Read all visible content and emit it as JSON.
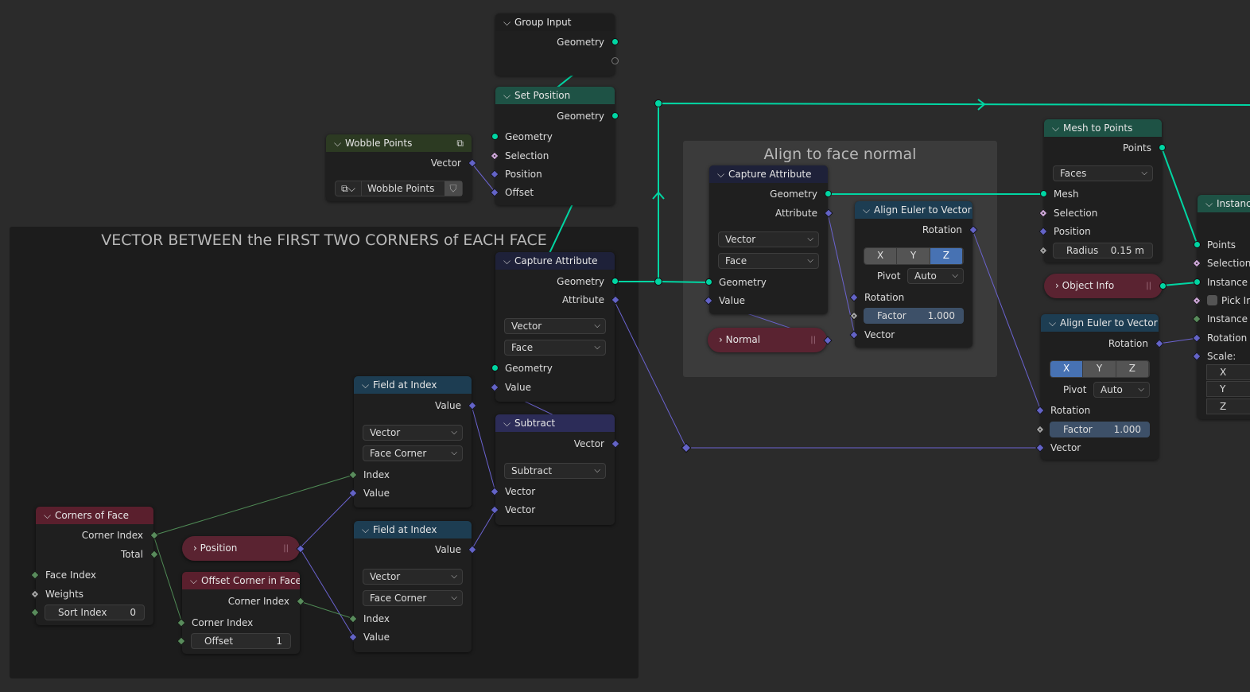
{
  "colors": {
    "background": "#2b2b2b",
    "geometry_socket": "#00d6a3",
    "vector_socket": "#6363c7",
    "int_socket": "#598c5c",
    "bool_socket": "#cca6d6",
    "float_socket": "#a1a1a1",
    "xyz_active": "#4772b3"
  },
  "frames": [
    {
      "id": "frame-vector",
      "title": "VECTOR BETWEEN the FIRST TWO CORNERS of EACH FACE"
    },
    {
      "id": "frame-align",
      "title": "Align to face normal"
    }
  ],
  "nodes": [
    {
      "id": "group-input",
      "title": "Group Input",
      "kind": "group",
      "rows": [
        {
          "t": "out",
          "label": "Geometry",
          "s": "geometry"
        },
        {
          "t": "out",
          "label": "",
          "s": "empty"
        }
      ]
    },
    {
      "id": "set-position",
      "title": "Set Position",
      "kind": "geometry",
      "rows": [
        {
          "t": "out",
          "label": "Geometry",
          "s": "geometry"
        },
        {
          "t": "in",
          "label": "Geometry",
          "s": "geometry"
        },
        {
          "t": "in",
          "label": "Selection",
          "s": "bool"
        },
        {
          "t": "in",
          "label": "Position",
          "s": "vector"
        },
        {
          "t": "in",
          "label": "Offset",
          "s": "vector"
        }
      ]
    },
    {
      "id": "wobble-points",
      "title": "Wobble Points",
      "kind": "nodegroup",
      "icon": "node-group-icon",
      "rows": [
        {
          "t": "out",
          "label": "Vector",
          "s": "vector"
        },
        {
          "t": "group",
          "value": "Wobble Points"
        }
      ]
    },
    {
      "id": "capture-attribute-1",
      "title": "Capture Attribute",
      "kind": "attribute",
      "rows": [
        {
          "t": "out",
          "label": "Geometry",
          "s": "geometry"
        },
        {
          "t": "out",
          "label": "Attribute",
          "s": "vector"
        },
        {
          "t": "select",
          "value": "Vector"
        },
        {
          "t": "select",
          "value": "Face"
        },
        {
          "t": "in",
          "label": "Geometry",
          "s": "geometry"
        },
        {
          "t": "in",
          "label": "Value",
          "s": "vector"
        }
      ]
    },
    {
      "id": "subtract",
      "title": "Subtract",
      "kind": "vector",
      "rows": [
        {
          "t": "out",
          "label": "Vector",
          "s": "vector"
        },
        {
          "t": "select",
          "value": "Subtract"
        },
        {
          "t": "in",
          "label": "Vector",
          "s": "vector"
        },
        {
          "t": "in",
          "label": "Vector",
          "s": "vector"
        }
      ]
    },
    {
      "id": "field-at-index-1",
      "title": "Field at Index",
      "kind": "utility",
      "rows": [
        {
          "t": "out",
          "label": "Value",
          "s": "vector"
        },
        {
          "t": "select",
          "value": "Vector"
        },
        {
          "t": "select",
          "value": "Face Corner"
        },
        {
          "t": "in",
          "label": "Index",
          "s": "int"
        },
        {
          "t": "in",
          "label": "Value",
          "s": "vector"
        }
      ]
    },
    {
      "id": "field-at-index-2",
      "title": "Field at Index",
      "kind": "utility",
      "rows": [
        {
          "t": "out",
          "label": "Value",
          "s": "vector"
        },
        {
          "t": "select",
          "value": "Vector"
        },
        {
          "t": "select",
          "value": "Face Corner"
        },
        {
          "t": "in",
          "label": "Index",
          "s": "int"
        },
        {
          "t": "in",
          "label": "Value",
          "s": "vector"
        }
      ]
    },
    {
      "id": "corners-of-face",
      "title": "Corners of Face",
      "kind": "input",
      "rows": [
        {
          "t": "out",
          "label": "Corner Index",
          "s": "int"
        },
        {
          "t": "out",
          "label": "Total",
          "s": "int"
        },
        {
          "t": "in",
          "label": "Face Index",
          "s": "int"
        },
        {
          "t": "in",
          "label": "Weights",
          "s": "float"
        },
        {
          "t": "num",
          "label": "Sort Index",
          "value": "0",
          "s": "int"
        }
      ]
    },
    {
      "id": "offset-corner-in-face",
      "title": "Offset Corner in Face",
      "kind": "input",
      "rows": [
        {
          "t": "out",
          "label": "Corner Index",
          "s": "int"
        },
        {
          "t": "in",
          "label": "Corner Index",
          "s": "int"
        },
        {
          "t": "num",
          "label": "Offset",
          "value": "1",
          "s": "int"
        }
      ]
    },
    {
      "id": "capture-attribute-2",
      "title": "Capture Attribute",
      "kind": "attribute",
      "rows": [
        {
          "t": "out",
          "label": "Geometry",
          "s": "geometry"
        },
        {
          "t": "out",
          "label": "Attribute",
          "s": "vector"
        },
        {
          "t": "select",
          "value": "Vector"
        },
        {
          "t": "select",
          "value": "Face"
        },
        {
          "t": "in",
          "label": "Geometry",
          "s": "geometry"
        },
        {
          "t": "in",
          "label": "Value",
          "s": "vector"
        }
      ]
    },
    {
      "id": "align-euler-1",
      "title": "Align Euler to Vector",
      "kind": "utility",
      "rows": [
        {
          "t": "out",
          "label": "Rotation",
          "s": "vector"
        },
        {
          "t": "xyz",
          "options": [
            "X",
            "Y",
            "Z"
          ],
          "active": "Z"
        },
        {
          "t": "pivot",
          "label": "Pivot",
          "value": "Auto"
        },
        {
          "t": "in",
          "label": "Rotation",
          "s": "vector"
        },
        {
          "t": "factor",
          "label": "Factor",
          "value": "1.000",
          "s": "float"
        },
        {
          "t": "in",
          "label": "Vector",
          "s": "vector"
        }
      ]
    },
    {
      "id": "mesh-to-points",
      "title": "Mesh to Points",
      "kind": "geometry",
      "rows": [
        {
          "t": "out",
          "label": "Points",
          "s": "geometry"
        },
        {
          "t": "select",
          "value": "Faces"
        },
        {
          "t": "in",
          "label": "Mesh",
          "s": "geometry"
        },
        {
          "t": "in",
          "label": "Selection",
          "s": "bool"
        },
        {
          "t": "in",
          "label": "Position",
          "s": "vector"
        },
        {
          "t": "num",
          "label": "Radius",
          "value": "0.15 m",
          "s": "float"
        }
      ]
    },
    {
      "id": "align-euler-2",
      "title": "Align Euler to Vector",
      "kind": "utility",
      "rows": [
        {
          "t": "out",
          "label": "Rotation",
          "s": "vector"
        },
        {
          "t": "xyz",
          "options": [
            "X",
            "Y",
            "Z"
          ],
          "active": "X"
        },
        {
          "t": "pivot",
          "label": "Pivot",
          "value": "Auto"
        },
        {
          "t": "in",
          "label": "Rotation",
          "s": "vector"
        },
        {
          "t": "factor",
          "label": "Factor",
          "value": "1.000",
          "s": "float"
        },
        {
          "t": "in",
          "label": "Vector",
          "s": "vector"
        }
      ]
    },
    {
      "id": "instance-on-points",
      "title": "Instance on Points",
      "kind": "geometry",
      "rows": [
        {
          "t": "in",
          "label": "Points",
          "s": "geometry"
        },
        {
          "t": "in",
          "label": "Selection",
          "s": "bool"
        },
        {
          "t": "in",
          "label": "Instance",
          "s": "geometry"
        },
        {
          "t": "check",
          "label": "Pick Instance",
          "s": "bool"
        },
        {
          "t": "in",
          "label": "Instance Index",
          "s": "int"
        },
        {
          "t": "in",
          "label": "Rotation",
          "s": "vector"
        },
        {
          "t": "in",
          "label": "Scale:",
          "s": "vector"
        },
        {
          "t": "vec",
          "label": "X"
        },
        {
          "t": "vec",
          "label": "Y"
        },
        {
          "t": "vec",
          "label": "Z"
        }
      ]
    }
  ],
  "collapsed_nodes": [
    {
      "id": "position",
      "title": "Position",
      "s": "vector"
    },
    {
      "id": "normal",
      "title": "Normal",
      "s": "vector"
    },
    {
      "id": "object-info",
      "title": "Object Info",
      "s": "geometry"
    }
  ]
}
